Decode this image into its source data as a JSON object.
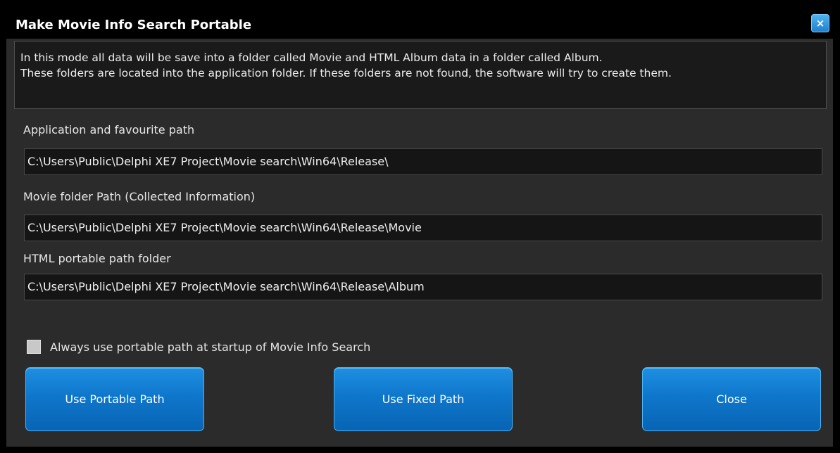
{
  "window": {
    "title": "Make Movie Info Search Portable"
  },
  "info": {
    "lines": [
      "In this mode all data will be save into a folder called Movie and  HTML Album data in a folder called Album.",
      "These folders are located into the application folder. If these folders are not found, the software will try to create them."
    ]
  },
  "fields": {
    "app_path": {
      "label": "Application  and favourite path",
      "value": "C:\\Users\\Public\\Delphi XE7 Project\\Movie search\\Win64\\Release\\"
    },
    "movie_path": {
      "label": "Movie folder Path (Collected Information)",
      "value": "C:\\Users\\Public\\Delphi XE7 Project\\Movie search\\Win64\\Release\\Movie"
    },
    "html_path": {
      "label": "HTML portable path folder",
      "value": "C:\\Users\\Public\\Delphi XE7 Project\\Movie search\\Win64\\Release\\Album"
    }
  },
  "checkbox": {
    "label": "Always use portable path at startup of Movie Info Search",
    "checked": false
  },
  "buttons": {
    "portable": "Use Portable Path",
    "fixed": "Use Fixed Path",
    "close": "Close"
  },
  "icons": {
    "close": "×"
  },
  "colors": {
    "accent": "#1585d8",
    "background": "#2b2b2b",
    "frame": "#000000"
  }
}
